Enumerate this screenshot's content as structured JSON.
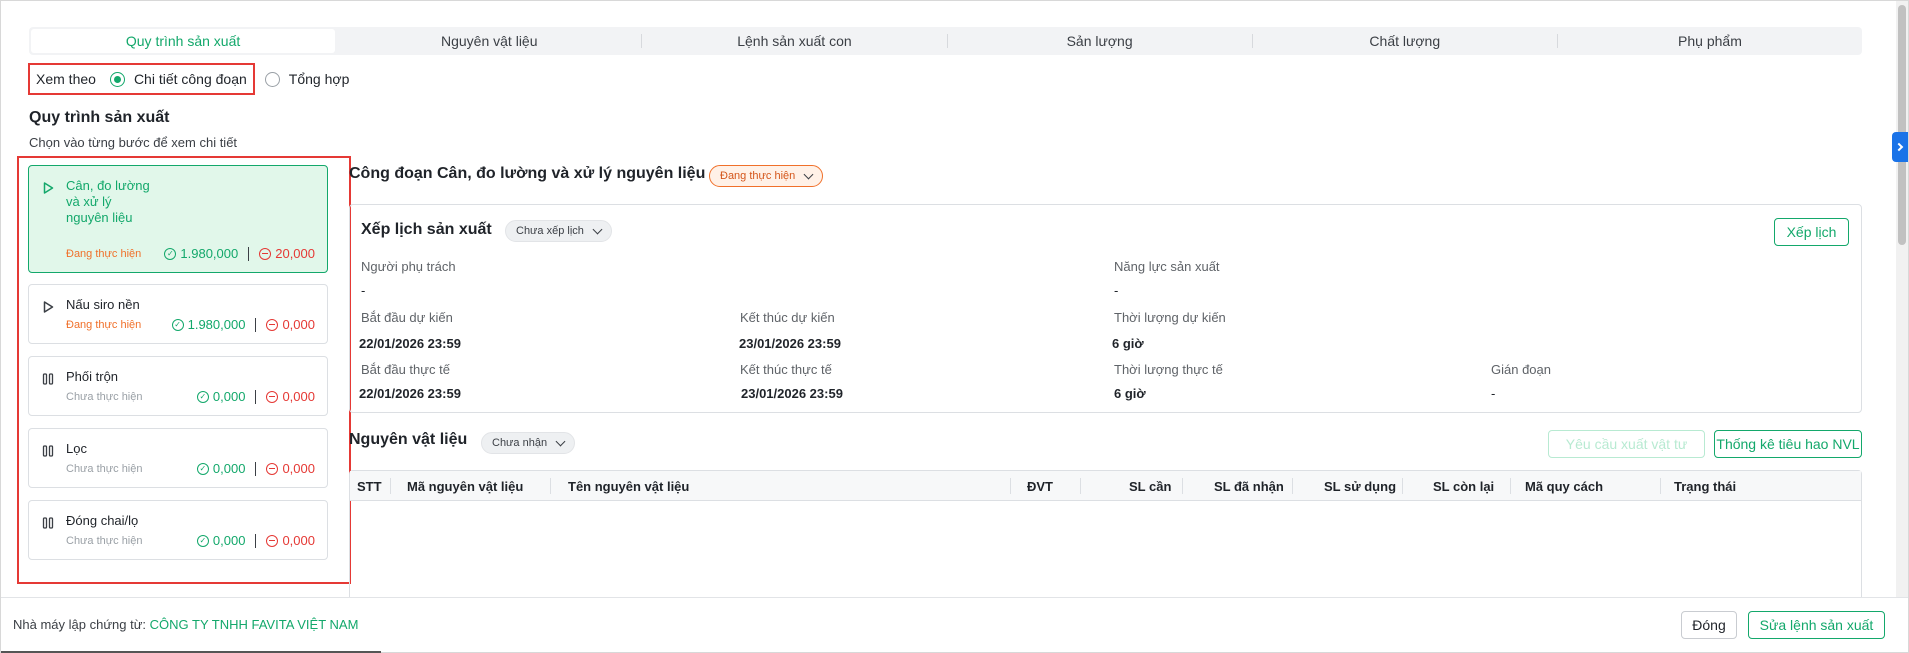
{
  "tabs": [
    {
      "label": "Quy trình sản xuất",
      "active": true
    },
    {
      "label": "Nguyên vật liệu",
      "active": false
    },
    {
      "label": "Lệnh sản xuất con",
      "active": false
    },
    {
      "label": "Sản lượng",
      "active": false
    },
    {
      "label": "Chất lượng",
      "active": false
    },
    {
      "label": "Phụ phẩm",
      "active": false
    }
  ],
  "view_mode": {
    "label": "Xem theo",
    "options": [
      "Chi tiết công đoạn",
      "Tổng hợp"
    ],
    "selected": "Chi tiết công đoạn"
  },
  "process": {
    "title": "Quy trình sản xuất",
    "subtitle": "Chọn vào từng bước để xem chi tiết",
    "steps": [
      {
        "name": "Cân, đo lường và xử lý nguyên liệu",
        "status": "Đang thực hiện",
        "good": "1.980,000",
        "bad": "20,000",
        "icon": "play-icon",
        "active": true
      },
      {
        "name": "Nấu siro nền",
        "status": "Đang thực hiện",
        "good": "1.980,000",
        "bad": "0,000",
        "icon": "play-icon",
        "active": false
      },
      {
        "name": "Phối trộn",
        "status": "Chưa thực hiện",
        "good": "0,000",
        "bad": "0,000",
        "icon": "pause-icon",
        "active": false
      },
      {
        "name": "Lọc",
        "status": "Chưa thực hiện",
        "good": "0,000",
        "bad": "0,000",
        "icon": "pause-icon",
        "active": false
      },
      {
        "name": "Đóng chai/lọ",
        "status": "Chưa thực hiện",
        "good": "0,000",
        "bad": "0,000",
        "icon": "pause-icon",
        "active": false
      }
    ]
  },
  "stage": {
    "title": "Công đoạn Cân, đo lường và xử lý nguyên liệu",
    "status": "Đang thực hiện"
  },
  "schedule": {
    "title": "Xếp lịch sản xuất",
    "status": "Chưa xếp lịch",
    "button": "Xếp lịch",
    "fields": {
      "owner_label": "Người phụ trách",
      "owner_value": "-",
      "capacity_label": "Năng lực sản xuất",
      "capacity_value": "-",
      "plan_start_label": "Bắt đầu dự kiến",
      "plan_start_value": "22/01/2026 23:59",
      "plan_end_label": "Kết thúc dự kiến",
      "plan_end_value": "23/01/2026 23:59",
      "plan_duration_label": "Thời lượng dự kiến",
      "plan_duration_value": "6 giờ",
      "actual_start_label": "Bắt đầu thực tế",
      "actual_start_value": "22/01/2026 23:59",
      "actual_end_label": "Kết thúc thực tế",
      "actual_end_value": "23/01/2026 23:59",
      "actual_duration_label": "Thời lượng thực tế",
      "actual_duration_value": "6 giờ",
      "interrupt_label": "Gián đoạn",
      "interrupt_value": "-"
    }
  },
  "materials": {
    "title": "Nguyên vật liệu",
    "status": "Chưa nhận",
    "request_button": "Yêu cầu xuất vật tư",
    "stats_button": "Thống kê tiêu hao NVL",
    "columns": [
      "STT",
      "Mã nguyên vật liệu",
      "Tên nguyên vật liệu",
      "ĐVT",
      "SL cần",
      "SL đã nhận",
      "SL sử dụng",
      "SL còn lại",
      "Mã quy cách",
      "Trạng thái"
    ]
  },
  "footer": {
    "label": "Nhà máy lập chứng từ:",
    "company": "CÔNG TY TNHH FAVITA VIỆT NAM",
    "close_button": "Đóng",
    "edit_button": "Sửa lệnh sản xuất"
  },
  "colors": {
    "accent": "#13a86b",
    "in_progress": "#f0702a",
    "error": "#e53935",
    "highlight_border": "#e53935"
  }
}
